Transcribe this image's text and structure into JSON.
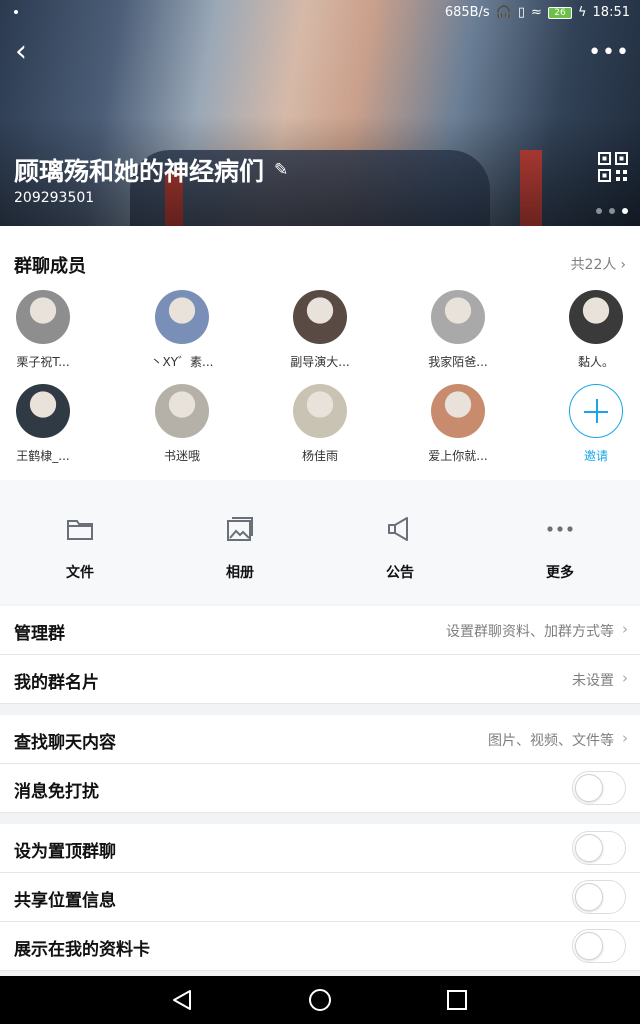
{
  "status_bar": {
    "speed": "685B/s",
    "battery": "26",
    "time": "18:51"
  },
  "header": {
    "group_name": "顾璃殇和她的神经病们",
    "group_id": "209293501"
  },
  "members": {
    "title": "群聊成员",
    "count": "共22人",
    "list": [
      {
        "name": "栗子祝T...",
        "color": "#8e8e8e"
      },
      {
        "name": "丶XY゛素...",
        "color": "#7a8fb8"
      },
      {
        "name": "副导演大...",
        "color": "#5a4a44"
      },
      {
        "name": "我家陌爸...",
        "color": "#a9a9a9"
      },
      {
        "name": "黏人。",
        "color": "#3a3a3a"
      },
      {
        "name": "王鹤棣_...",
        "color": "#2f3a44"
      },
      {
        "name": "书迷哦",
        "color": "#b5b0a8"
      },
      {
        "name": "杨佳雨",
        "color": "#c8c3b3"
      },
      {
        "name": "爱上你就...",
        "color": "#c98b6d"
      }
    ],
    "invite_label": "邀请"
  },
  "actions": [
    {
      "label": "文件",
      "icon": "folder-icon"
    },
    {
      "label": "相册",
      "icon": "album-icon"
    },
    {
      "label": "公告",
      "icon": "megaphone-icon"
    },
    {
      "label": "更多",
      "icon": "more-dots-icon"
    }
  ],
  "settings": {
    "manage": {
      "title": "管理群",
      "value": "设置群聊资料、加群方式等"
    },
    "card": {
      "title": "我的群名片",
      "value": "未设置"
    },
    "search": {
      "title": "查找聊天内容",
      "value": "图片、视频、文件等"
    },
    "mute": {
      "title": "消息免打扰"
    },
    "pin": {
      "title": "设为置顶群聊"
    },
    "location": {
      "title": "共享位置信息"
    },
    "show_card": {
      "title": "展示在我的资料卡"
    }
  }
}
